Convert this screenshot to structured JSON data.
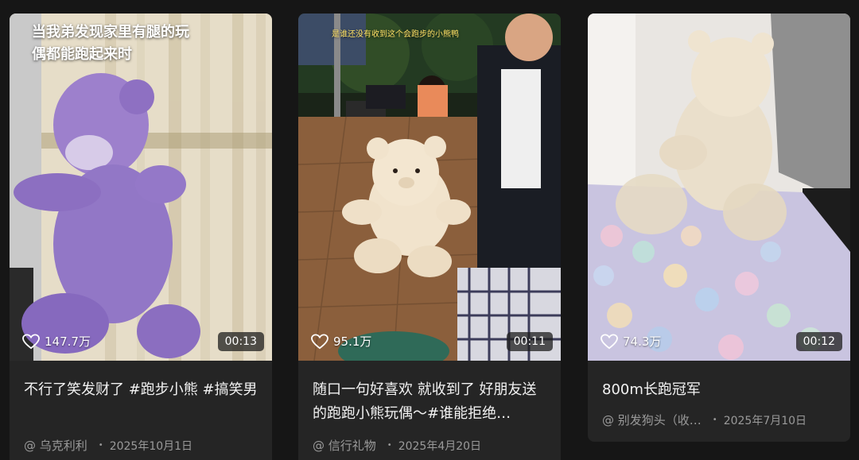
{
  "cards": [
    {
      "overlay": "当我弟发现家里有腿的玩偶都能跑起来时",
      "likes": "147.7万",
      "duration": "00:13",
      "title": "不行了笑发财了 #跑步小熊 #搞笑男",
      "author": "@ 乌克利利",
      "date": "2025年10月1日"
    },
    {
      "overlay": "是谁还没有收到这个会跑步的小熊鸭",
      "likes": "95.1万",
      "duration": "00:11",
      "title": "随口一句好喜欢 就收到了 好朋友送的跑跑小熊玩偶～#谁能拒绝…",
      "author": "@ 信行礼物",
      "date": "2025年4月20日"
    },
    {
      "likes": "74.3万",
      "duration": "00:12",
      "title": "800m长跑冠军",
      "author": "@ 别发狗头（收…",
      "date": "2025年7月10日"
    }
  ],
  "separator": "•",
  "icons": {
    "like": "heart-outline-icon"
  },
  "colors": {
    "background": "#161616",
    "card": "#252525",
    "meta": "#9a9a9a",
    "overlay_yellow": "#ffe266"
  }
}
